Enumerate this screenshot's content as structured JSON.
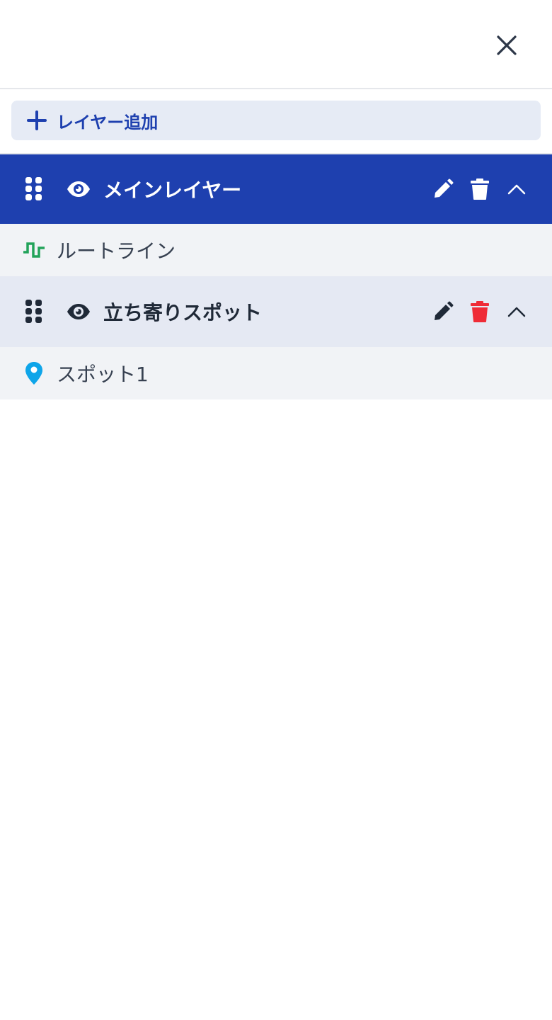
{
  "toolbar": {
    "add_layer_label": "レイヤー追加"
  },
  "layers": [
    {
      "title": "メインレイヤー",
      "active": true,
      "items": [
        {
          "label": "ルートライン",
          "icon": "route-line-icon",
          "icon_color": "#22a35a"
        }
      ]
    },
    {
      "title": "立ち寄りスポット",
      "active": false,
      "items": [
        {
          "label": "スポット1",
          "icon": "map-pin-icon",
          "icon_color": "#0ea5e9"
        }
      ]
    }
  ],
  "colors": {
    "accent": "#1e40af",
    "delete_red": "#ef2b36",
    "route_green": "#22a35a",
    "pin_blue": "#0ea5e9"
  }
}
